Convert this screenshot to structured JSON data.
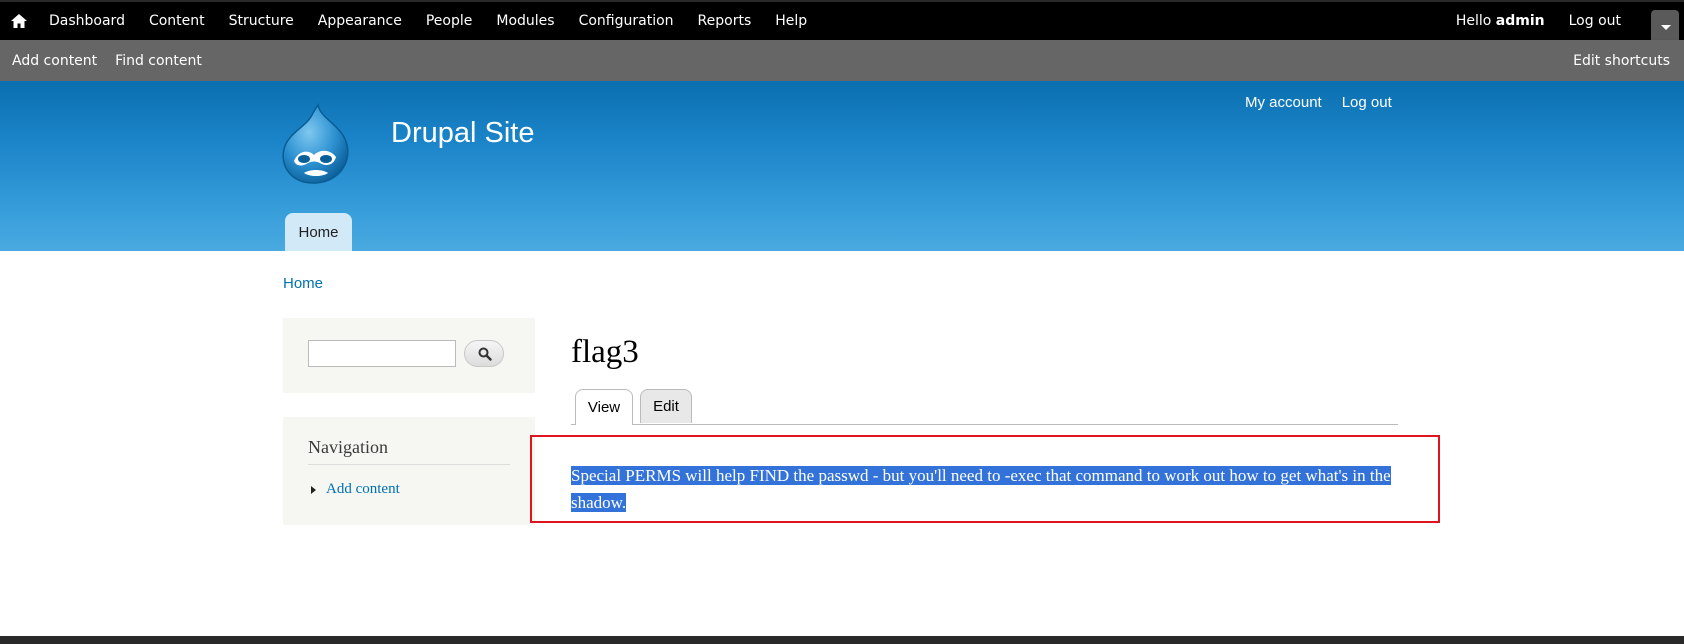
{
  "toolbar": {
    "menu": [
      "Dashboard",
      "Content",
      "Structure",
      "Appearance",
      "People",
      "Modules",
      "Configuration",
      "Reports",
      "Help"
    ],
    "hello_prefix": "Hello ",
    "username": "admin",
    "logout": "Log out"
  },
  "shortcuts": {
    "add_content": "Add content",
    "find_content": "Find content",
    "edit_shortcuts": "Edit shortcuts"
  },
  "header": {
    "site_name": "Drupal Site",
    "secondary_menu": [
      "My account",
      "Log out"
    ],
    "main_tab": "Home"
  },
  "breadcrumb": "Home",
  "sidebar": {
    "search": {
      "value": "",
      "placeholder": ""
    },
    "navigation": {
      "title": "Navigation",
      "items": [
        "Add content"
      ]
    }
  },
  "main": {
    "title": "flag3",
    "tabs": [
      "View",
      "Edit"
    ],
    "active_tab": "View",
    "body": "Special PERMS will help FIND the passwd - but you'll need to -exec that command to work out how to get what's in the shadow."
  },
  "colors": {
    "toolbar": "#000000",
    "shortcuts": "#666666",
    "header_top": "#0a6fb0",
    "header_bottom": "#4aa9e0",
    "link": "#0071b3",
    "selection": "#3372d8",
    "highlight_border": "#e0141e"
  }
}
